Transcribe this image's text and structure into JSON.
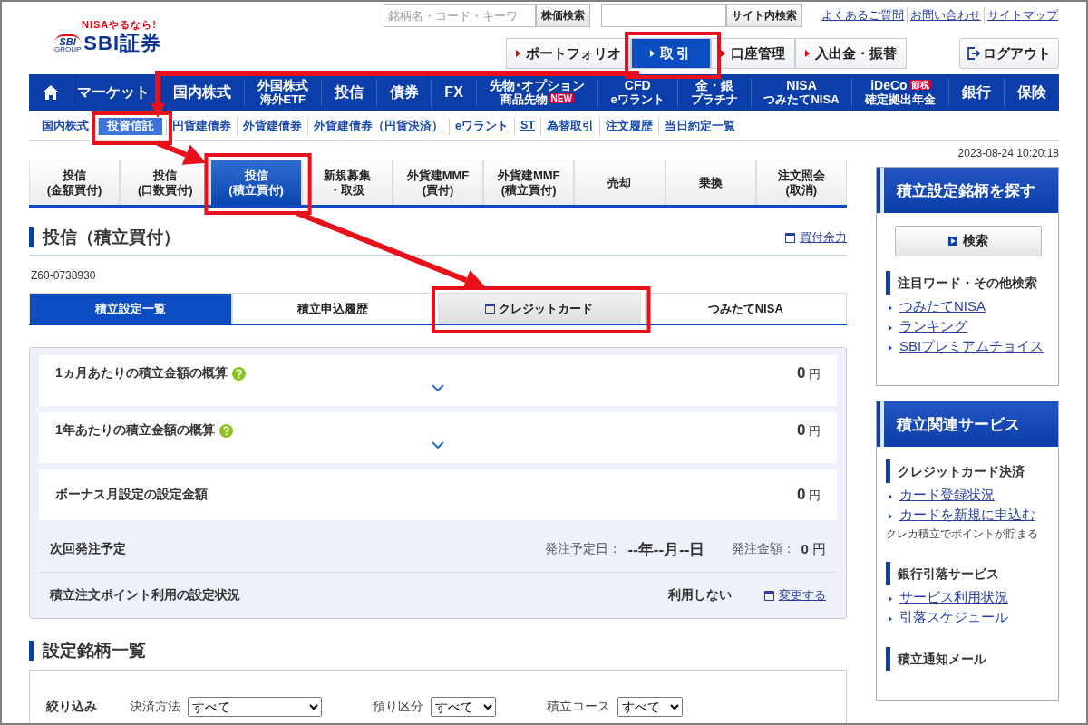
{
  "header": {
    "logo": {
      "tagline": "NISAやるなら!",
      "mark": "SBI",
      "mark_sub": "GROUP",
      "name": "SBI証券"
    },
    "stock_search": {
      "placeholder": "銘柄名・コード・キーワ",
      "button": "株価検索"
    },
    "site_search": {
      "button": "サイト内検索"
    },
    "help_links": [
      "よくあるご質問",
      "お問い合わせ",
      "サイトマップ"
    ],
    "top_buttons": [
      {
        "label": "ポートフォリオ",
        "selected": false,
        "highlighted": false
      },
      {
        "label": "取引",
        "selected": true,
        "highlighted": true
      },
      {
        "label": "口座管理",
        "selected": false,
        "highlighted": false
      },
      {
        "label": "入出金・振替",
        "selected": false,
        "highlighted": false
      }
    ],
    "logout": "ログアウト"
  },
  "nav": [
    {
      "kind": "home"
    },
    {
      "kind": "text",
      "lines": [
        {
          "text": "マーケット"
        }
      ]
    },
    {
      "kind": "text",
      "lines": [
        {
          "text": "国内株式"
        }
      ]
    },
    {
      "kind": "text",
      "lines": [
        {
          "text": "外国株式"
        },
        {
          "text": "海外ETF"
        }
      ]
    },
    {
      "kind": "text",
      "lines": [
        {
          "text": "投信"
        }
      ]
    },
    {
      "kind": "text",
      "lines": [
        {
          "text": "債券"
        }
      ]
    },
    {
      "kind": "text",
      "lines": [
        {
          "text": "FX"
        }
      ]
    },
    {
      "kind": "text",
      "lines": [
        {
          "text": "先物･オプション"
        },
        {
          "text": "商品先物",
          "badge": "NEW"
        }
      ]
    },
    {
      "kind": "text",
      "lines": [
        {
          "text": "CFD"
        },
        {
          "text": "eワラント"
        }
      ]
    },
    {
      "kind": "text",
      "lines": [
        {
          "text": "金・銀"
        },
        {
          "text": "プラチナ"
        }
      ]
    },
    {
      "kind": "text",
      "lines": [
        {
          "text": "NISA"
        },
        {
          "text": "つみたてNISA"
        }
      ]
    },
    {
      "kind": "text",
      "lines": [
        {
          "text": "iDeCo",
          "badge": "節税"
        },
        {
          "text": "確定拠出年金"
        }
      ]
    },
    {
      "kind": "text",
      "lines": [
        {
          "text": "銀行"
        }
      ]
    },
    {
      "kind": "text",
      "lines": [
        {
          "text": "保険"
        }
      ]
    }
  ],
  "subnav": [
    {
      "label": "国内株式",
      "selected": false,
      "highlighted": false
    },
    {
      "label": "投資信託",
      "selected": true,
      "highlighted": true
    },
    {
      "label": "円貨建債券",
      "selected": false,
      "highlighted": false
    },
    {
      "label": "外貨建債券",
      "selected": false,
      "highlighted": false
    },
    {
      "label": "外貨建債券（円貨決済）",
      "selected": false,
      "highlighted": false
    },
    {
      "label": "eワラント",
      "selected": false,
      "highlighted": false
    },
    {
      "label": "ST",
      "selected": false,
      "highlighted": false
    },
    {
      "label": "為替取引",
      "selected": false,
      "highlighted": false
    },
    {
      "label": "注文履歴",
      "selected": false,
      "highlighted": false
    },
    {
      "label": "当日約定一覧",
      "selected": false,
      "highlighted": false
    }
  ],
  "timestamp": "2023-08-24 10:20:18",
  "tabs": [
    {
      "lines": [
        "投信",
        "(金額買付)"
      ],
      "selected": false,
      "highlighted": false
    },
    {
      "lines": [
        "投信",
        "(口数買付)"
      ],
      "selected": false,
      "highlighted": false
    },
    {
      "lines": [
        "投信",
        "(積立買付)"
      ],
      "selected": true,
      "highlighted": true
    },
    {
      "lines": [
        "新規募集",
        "・取扱"
      ],
      "selected": false,
      "highlighted": false
    },
    {
      "lines": [
        "外貨建MMF",
        "(買付)"
      ],
      "selected": false,
      "highlighted": false
    },
    {
      "lines": [
        "外貨建MMF",
        "(積立買付)"
      ],
      "selected": false,
      "highlighted": false
    },
    {
      "lines": [
        "売却"
      ],
      "selected": false,
      "highlighted": false
    },
    {
      "lines": [
        "乗換"
      ],
      "selected": false,
      "highlighted": false
    },
    {
      "lines": [
        "注文照会",
        "(取消)"
      ],
      "selected": false,
      "highlighted": false
    }
  ],
  "page_title": "投信（積立買付）",
  "buying_power_link": "買付余力",
  "account_code": "Z60-0738930",
  "subtabs": [
    {
      "kind": "tab",
      "label": "積立設定一覧",
      "selected": true,
      "highlighted": false
    },
    {
      "kind": "tab",
      "label": "積立申込履歴",
      "selected": false,
      "highlighted": false
    },
    {
      "kind": "window",
      "label": "クレジットカード",
      "selected": false,
      "highlighted": true
    },
    {
      "kind": "tab",
      "label": "つみたてNISA",
      "selected": false,
      "highlighted": false
    }
  ],
  "summary": {
    "rows": [
      {
        "label": "1ヵ月あたりの積立金額の概算",
        "help": true,
        "expandable": true,
        "amount": "0",
        "unit": "円"
      },
      {
        "label": "1年あたりの積立金額の概算",
        "help": true,
        "expandable": true,
        "amount": "0",
        "unit": "円"
      },
      {
        "label": "ボーナス月設定の設定金額",
        "help": false,
        "expandable": false,
        "amount": "0",
        "unit": "円"
      }
    ],
    "next_order": {
      "label": "次回発注予定",
      "date_label": "発注予定日：",
      "date": "--年--月--日",
      "amount_label": "発注金額：",
      "amount": "0",
      "unit": "円"
    },
    "points": {
      "label": "積立注文ポイント利用の設定状況",
      "value": "利用しない",
      "link": "変更する"
    }
  },
  "list_section": {
    "title": "設定銘柄一覧",
    "filter_label": "絞り込み",
    "filters": [
      {
        "label": "決済方法",
        "value": "すべて"
      },
      {
        "label": "預り区分",
        "value": "すべて"
      },
      {
        "label": "積立コース",
        "value": "すべて"
      }
    ]
  },
  "sidebar": [
    {
      "title": "積立設定銘柄を探す",
      "button": "検索",
      "groups": [
        {
          "heading": "注目ワード・その他検索",
          "links": [
            "つみたてNISA",
            "ランキング",
            "SBIプレミアムチョイス"
          ]
        }
      ]
    },
    {
      "title": "積立関連サービス",
      "groups": [
        {
          "heading": "クレジットカード決済",
          "links": [
            "カード登録状況",
            "カードを新規に申込む"
          ],
          "note": "クレカ積立でポイントが貯まる"
        },
        {
          "heading": "銀行引落サービス",
          "links": [
            "サービス利用状況",
            "引落スケジュール"
          ]
        },
        {
          "heading": "積立通知メール"
        }
      ]
    }
  ]
}
